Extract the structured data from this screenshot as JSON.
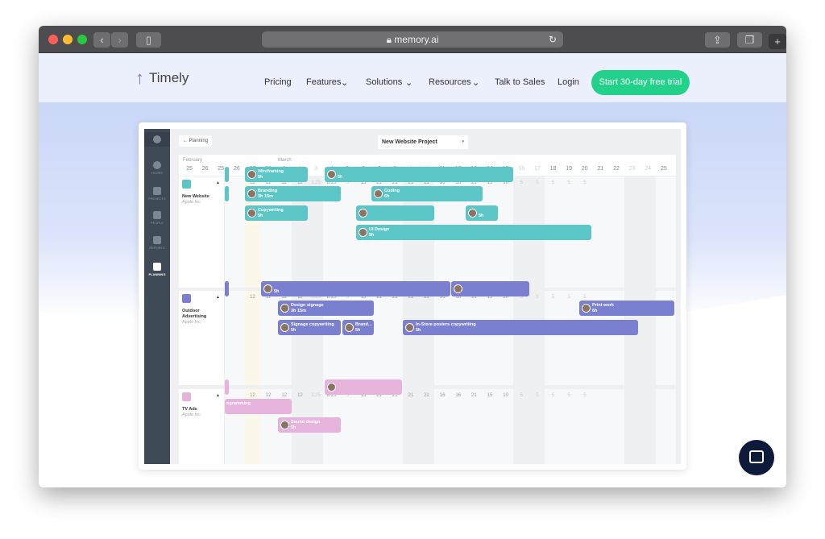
{
  "browser": {
    "url": "memory.ai"
  },
  "nav": {
    "logo": "Timely",
    "items": [
      "Pricing",
      "Features",
      "Solutions",
      "Resources",
      "Talk to Sales",
      "Login"
    ],
    "cta": "Start 30-day free trial"
  },
  "app": {
    "sidebar": [
      "HOURS",
      "PROJECTS",
      "PEOPLE",
      "REPORTS",
      "PLANNING"
    ],
    "back": "Planning",
    "project_select": "New Website Project",
    "months": [
      "February",
      "March"
    ],
    "dates": [
      "25",
      "26",
      "25",
      "26",
      "27",
      "28",
      "1",
      "2",
      "3",
      "4",
      "5",
      "6",
      "7",
      "8",
      "9",
      "10",
      "11",
      "12",
      "13",
      "14",
      "15",
      "16",
      "17",
      "18",
      "19",
      "20",
      "21",
      "22",
      "23",
      "24",
      "25"
    ],
    "hours": [
      "12",
      "12",
      "12",
      "12",
      "3.25",
      "8.25",
      "5",
      "15",
      "21",
      "21",
      "21",
      "21",
      "16",
      "16",
      "21",
      "15",
      "10",
      "5",
      "5",
      "5",
      "5",
      "5"
    ],
    "projects": [
      {
        "name": "New Website",
        "client": "Apple Inc",
        "color": "#5cc6c6",
        "bars": [
          {
            "label": "Wireframing",
            "hours": "5h"
          },
          {
            "label": "",
            "hours": "5h"
          },
          {
            "label": "Branding",
            "hours": "3h 15m"
          },
          {
            "label": "Coding",
            "hours": "6h"
          },
          {
            "label": "Copywriting",
            "hours": "5h"
          },
          {
            "label": "",
            "hours": ""
          },
          {
            "label": "",
            "hours": "5h"
          },
          {
            "label": "UI Design",
            "hours": "5h"
          }
        ]
      },
      {
        "name": "Outdoor Advertising",
        "client": "Apple Inc",
        "color": "#7b7fd0",
        "bars": [
          {
            "label": "",
            "hours": "5h"
          },
          {
            "label": "",
            "hours": ""
          },
          {
            "label": "Design signage",
            "hours": "3h 15m"
          },
          {
            "label": "Print work",
            "hours": "6h"
          },
          {
            "label": "Signage copywriting",
            "hours": "5h"
          },
          {
            "label": "Brand...",
            "hours": "5h"
          },
          {
            "label": "In-Store posters copywriting",
            "hours": "5h"
          }
        ]
      },
      {
        "name": "TV Ads",
        "client": "Apple Inc",
        "color": "#e6b3dc",
        "bars": [
          {
            "label": "",
            "hours": ""
          },
          {
            "label": "ogramming",
            "hours": ""
          },
          {
            "label": "Sound design",
            "hours": "5h"
          }
        ]
      }
    ]
  }
}
